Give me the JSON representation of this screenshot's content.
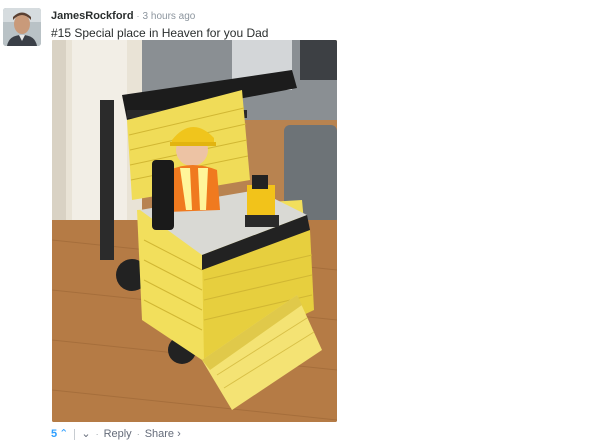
{
  "comment": {
    "username": "JamesRockford",
    "timestamp": "3 hours ago",
    "text": "#15 Special place in Heaven for you Dad"
  },
  "footer": {
    "upvotes": "5",
    "reply_label": "Reply",
    "share_label": "Share ›"
  },
  "icons": {
    "upvote": "chevron-up-icon",
    "downvote": "chevron-down-icon"
  },
  "colors": {
    "link_blue": "#2e9fff",
    "meta_gray": "#656c7a"
  }
}
